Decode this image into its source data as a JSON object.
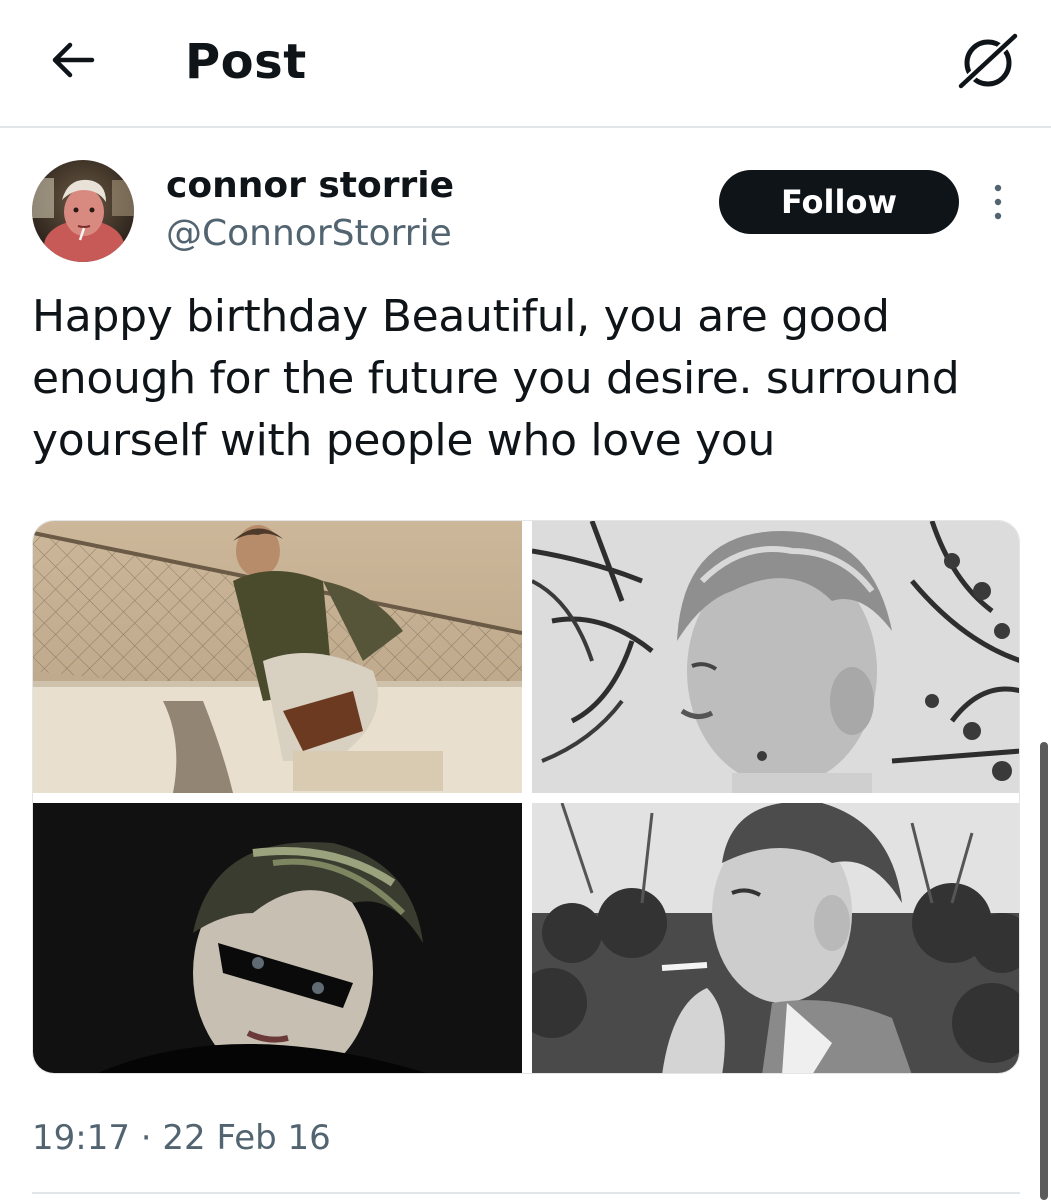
{
  "header": {
    "back_icon": "arrow-left-icon",
    "title": "Post",
    "grok_icon": "grok-icon"
  },
  "author": {
    "name": "connor storrie",
    "handle": "@ConnorStorrie",
    "follow_label": "Follow",
    "more_icon": "more-vertical-icon"
  },
  "tweet": {
    "lines": [
      "Happy birthday Beautiful, you are good",
      "enough for the future you desire. surround",
      "yourself with people who love you"
    ]
  },
  "media": {
    "count": 4,
    "photos": [
      {
        "tone": "sepia",
        "subject": "man seated by chain-link fence"
      },
      {
        "tone": "grayscale",
        "subject": "profile portrait with trees"
      },
      {
        "tone": "dark",
        "subject": "portrait with black eye paint"
      },
      {
        "tone": "grayscale",
        "subject": "man smoking outdoors"
      }
    ]
  },
  "meta": {
    "time": "19:17",
    "separator": " · ",
    "date": "22 Feb 16"
  },
  "colors": {
    "text": "#0f1419",
    "secondary": "#536471",
    "divider": "#e3e6e8",
    "follow_bg": "#0f1419",
    "follow_text": "#ffffff"
  }
}
